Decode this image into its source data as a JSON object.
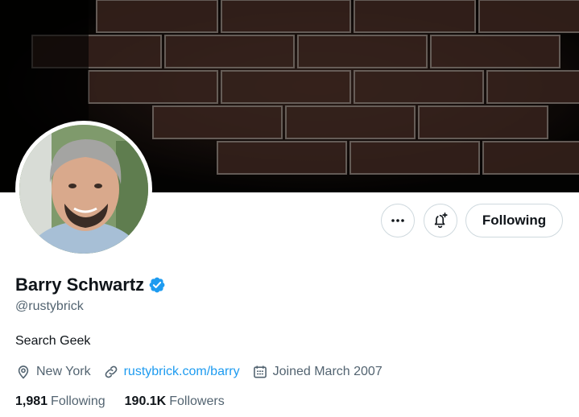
{
  "profile": {
    "name": "Barry Schwartz",
    "handle": "@rustybrick",
    "bio": "Search Geek",
    "location": "New York",
    "website": "rustybrick.com/barry",
    "joined": "Joined March 2007",
    "verified": true
  },
  "actions": {
    "more_icon": "more-horizontal-icon",
    "notify_icon": "bell-plus-icon",
    "follow_label": "Following"
  },
  "stats": {
    "following_count": "1,981",
    "following_label": "Following",
    "followers_count": "190.1K",
    "followers_label": "Followers"
  },
  "colors": {
    "accent": "#1d9bf0",
    "text_primary": "#0f1419",
    "text_secondary": "#536471",
    "border": "#cfd9de"
  }
}
